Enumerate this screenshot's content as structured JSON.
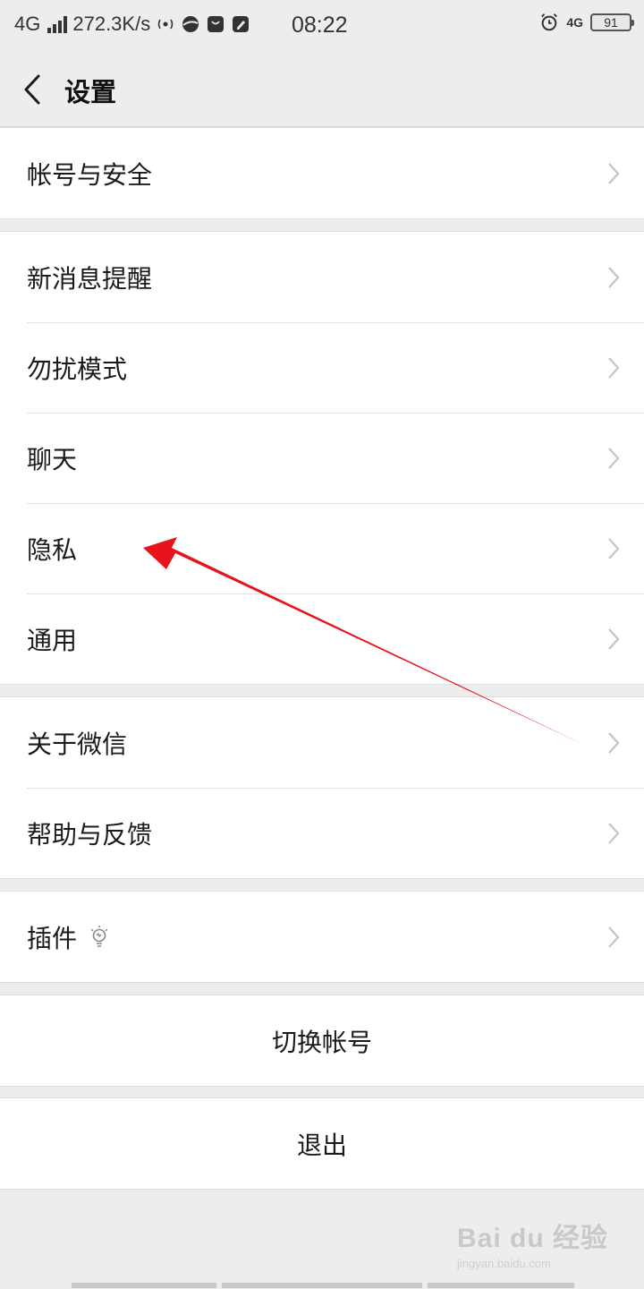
{
  "status_bar": {
    "network": "4G",
    "speed": "272.3K/s",
    "time": "08:22",
    "net_right": "4G",
    "battery": "91"
  },
  "nav": {
    "title": "设置"
  },
  "groups": {
    "account": [
      "帐号与安全"
    ],
    "settings": [
      "新消息提醒",
      "勿扰模式",
      "聊天",
      "隐私",
      "通用"
    ],
    "about": [
      "关于微信",
      "帮助与反馈"
    ],
    "plugins": [
      "插件"
    ]
  },
  "actions": {
    "switch_account": "切换帐号",
    "logout": "退出"
  },
  "annotation": {
    "arrow_color": "#e8141b",
    "points_to": "隐私"
  },
  "watermark": {
    "main": "Bai du 经验",
    "sub": "jingyan.baidu.com"
  },
  "colors": {
    "background": "#ededed",
    "cell": "#ffffff",
    "divider": "#e3e3e3",
    "chevron": "#c4c4c4"
  }
}
